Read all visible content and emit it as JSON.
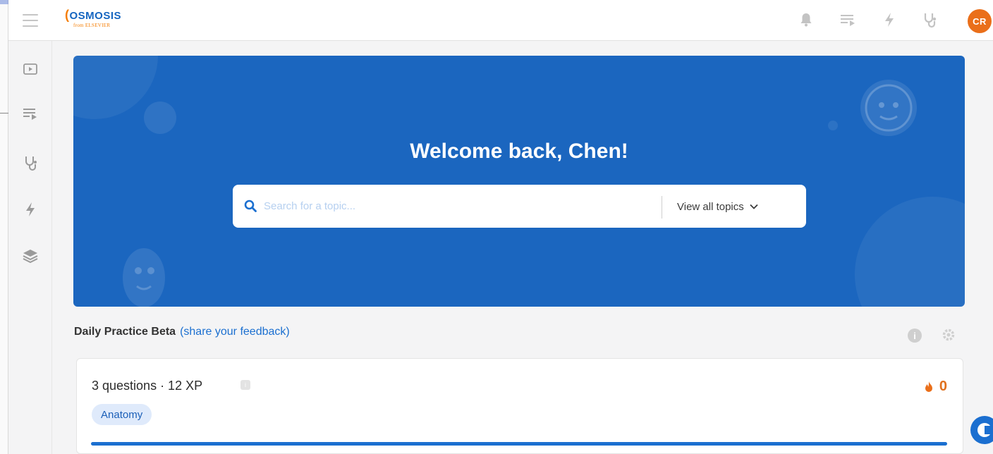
{
  "header": {
    "logo_brand": "OSMOSIS",
    "logo_sub": "from ELSEVIER",
    "avatar_initials": "CR",
    "icons": [
      "bell-icon",
      "playlist-icon",
      "flash-icon",
      "stethoscope-icon"
    ]
  },
  "sidebar": {
    "items": [
      "video-icon",
      "playlist-icon",
      "stethoscope-icon",
      "flash-icon",
      "layers-icon"
    ]
  },
  "hero": {
    "title": "Welcome back, Chen!",
    "search_placeholder": "Search for a topic...",
    "view_all_label": "View all topics"
  },
  "daily_practice": {
    "title": "Daily Practice Beta",
    "feedback_link": "(share your feedback)",
    "info_glyph": "i",
    "card": {
      "summary": "3 questions · 12 XP",
      "tag": "Anatomy",
      "streak": "0"
    }
  },
  "colors": {
    "brand_blue": "#1b66bf",
    "accent_orange": "#ea6f1a"
  }
}
